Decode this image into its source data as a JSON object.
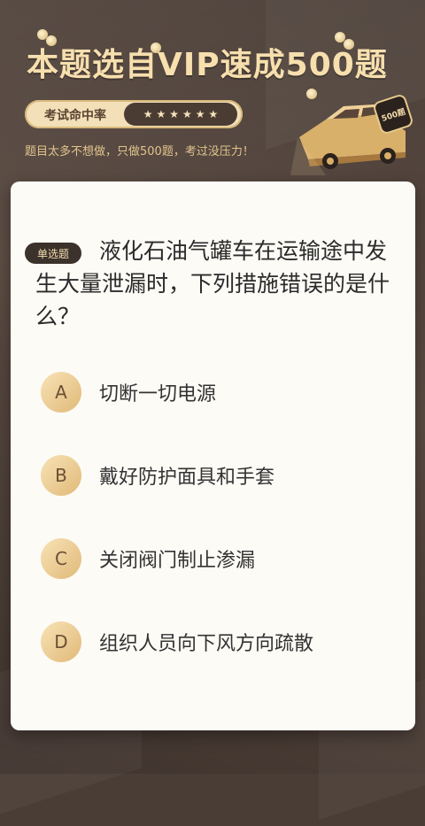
{
  "header": {
    "title": "本题选自VIP速成500题",
    "pill_label": "考试命中率",
    "stars": [
      "★",
      "★",
      "★",
      "★",
      "★",
      "★"
    ],
    "subtitle": "题目太多不想做，只做500题，考过没压力！",
    "badge": "500题"
  },
  "question": {
    "tag": "单选题",
    "text": "液化石油气罐车在运输途中发生大量泄漏时，下列措施错误的是什么？"
  },
  "options": [
    {
      "letter": "A",
      "text": "切断一切电源"
    },
    {
      "letter": "B",
      "text": "戴好防护面具和手套"
    },
    {
      "letter": "C",
      "text": "关闭阀门制止渗漏"
    },
    {
      "letter": "D",
      "text": "组织人员向下风方向疏散"
    }
  ],
  "colors": {
    "background": "#4a3d36",
    "title_gold": "#f7dfae",
    "card": "#fdfbf6",
    "option_circle": "#e0b978"
  }
}
